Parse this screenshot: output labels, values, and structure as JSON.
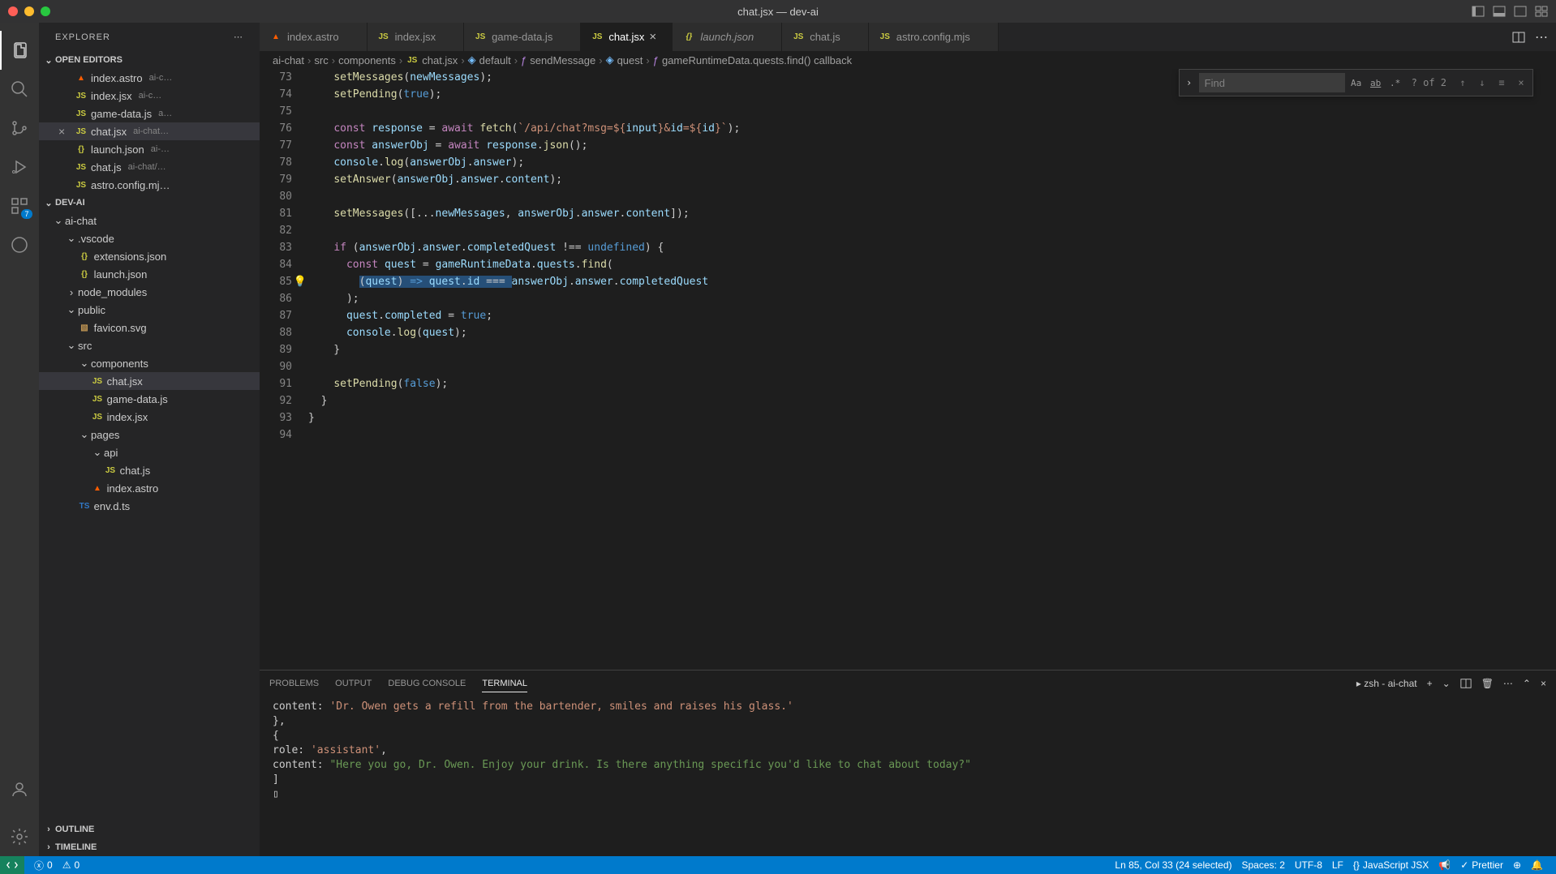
{
  "window": {
    "title": "chat.jsx — dev-ai"
  },
  "activityBar": {
    "extensionsBadge": "7"
  },
  "sidebar": {
    "title": "EXPLORER",
    "sections": {
      "openEditors": "OPEN EDITORS",
      "project": "DEV-AI",
      "outline": "OUTLINE",
      "timeline": "TIMELINE"
    },
    "openEditors": [
      {
        "name": "index.astro",
        "path": "ai-c…",
        "icon": "astro"
      },
      {
        "name": "index.jsx",
        "path": "ai-c…",
        "icon": "jsx"
      },
      {
        "name": "game-data.js",
        "path": "a…",
        "icon": "js"
      },
      {
        "name": "chat.jsx",
        "path": "ai-chat…",
        "icon": "jsx",
        "active": true
      },
      {
        "name": "launch.json",
        "path": "ai-…",
        "icon": "json"
      },
      {
        "name": "chat.js",
        "path": "ai-chat/…",
        "icon": "js"
      },
      {
        "name": "astro.config.mj…",
        "path": "",
        "icon": "js"
      }
    ],
    "tree": {
      "root": "ai-chat",
      "vscode": ".vscode",
      "extensions": "extensions.json",
      "launch": "launch.json",
      "nodeModules": "node_modules",
      "public": "public",
      "favicon": "favicon.svg",
      "src": "src",
      "components": "components",
      "chatJsx": "chat.jsx",
      "gameData": "game-data.js",
      "indexJsx": "index.jsx",
      "pages": "pages",
      "api": "api",
      "chatJs": "chat.js",
      "indexAstro": "index.astro",
      "envDts": "env.d.ts"
    }
  },
  "tabs": [
    {
      "name": "index.astro",
      "icon": "astro"
    },
    {
      "name": "index.jsx",
      "icon": "jsx"
    },
    {
      "name": "game-data.js",
      "icon": "js"
    },
    {
      "name": "chat.jsx",
      "icon": "jsx",
      "active": true
    },
    {
      "name": "launch.json",
      "icon": "json",
      "italic": true
    },
    {
      "name": "chat.js",
      "icon": "js"
    },
    {
      "name": "astro.config.mjs",
      "icon": "js"
    }
  ],
  "breadcrumbs": {
    "p1": "ai-chat",
    "p2": "src",
    "p3": "components",
    "p4": "chat.jsx",
    "p5": "default",
    "p6": "sendMessage",
    "p7": "quest",
    "p8": "gameRuntimeData.quests.find() callback"
  },
  "find": {
    "placeholder": "Find",
    "count": "? of 2"
  },
  "code": {
    "startLine": 73,
    "lines": [
      "    setMessages(newMessages);",
      "    setPending(true);",
      "",
      "    const response = await fetch(`/api/chat?msg=${input}&id=${id}`);",
      "    const answerObj = await response.json();",
      "    console.log(answerObj.answer);",
      "    setAnswer(answerObj.answer.content);",
      "",
      "    setMessages([...newMessages, answerObj.answer.content]);",
      "",
      "    if (answerObj.answer.completedQuest !== undefined) {",
      "      const quest = gameRuntimeData.quests.find(",
      "        (quest) => quest.id === answerObj.answer.completedQuest",
      "      );",
      "      quest.completed = true;",
      "      console.log(quest);",
      "    }",
      "",
      "    setPending(false);",
      "  }",
      "}",
      ""
    ]
  },
  "panel": {
    "tabs": {
      "problems": "PROBLEMS",
      "output": "OUTPUT",
      "debug": "DEBUG CONSOLE",
      "terminal": "TERMINAL"
    },
    "shell": "zsh - ai-chat",
    "lines": {
      "l1a": "    content: ",
      "l1b": "'Dr. Owen gets a refill from the bartender, smiles and raises his glass.'",
      "l2": "  },",
      "l3": "  {",
      "l4a": "    role: ",
      "l4b": "'assistant'",
      "l4c": ",",
      "l5a": "    content: ",
      "l5b": "\"Here you go, Dr. Owen. Enjoy your drink. Is there anything specific you'd like to chat about today?\"",
      "l6": "]",
      "l7": "▯"
    }
  },
  "statusbar": {
    "errors": "0",
    "warnings": "0",
    "cursor": "Ln 85, Col 33 (24 selected)",
    "spaces": "Spaces: 2",
    "encoding": "UTF-8",
    "eol": "LF",
    "lang": "JavaScript JSX",
    "prettier": "Prettier"
  }
}
